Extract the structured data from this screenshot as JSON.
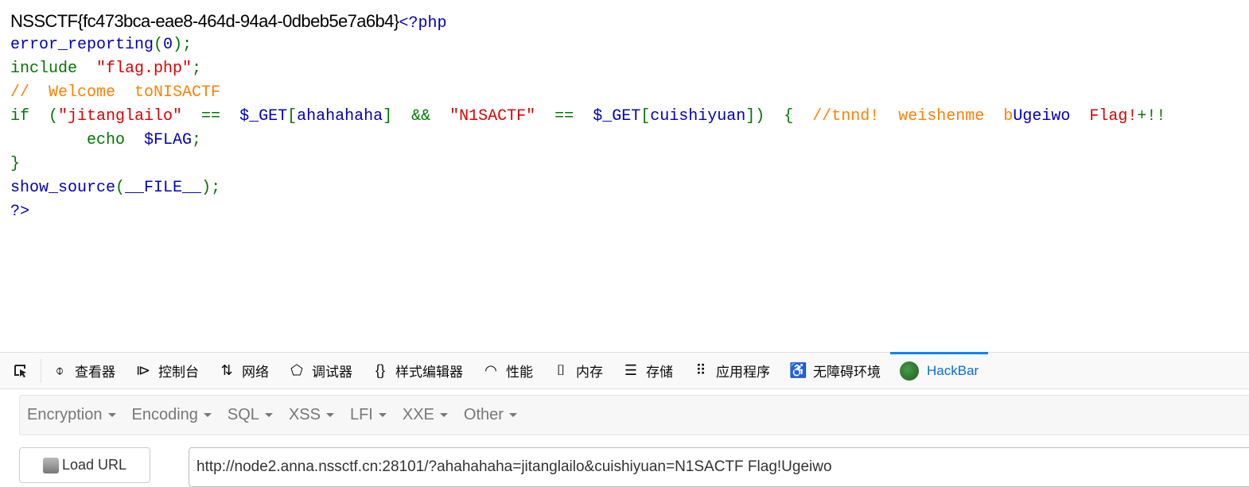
{
  "page": {
    "flag_text": "NSSCTF{fc473bca-eae8-464d-94a4-0dbeb5e7a6b4}",
    "source_lines": [
      [
        [
          "<?php",
          "default"
        ]
      ],
      [
        [
          "error_reporting",
          "default"
        ],
        [
          "(",
          "keyword"
        ],
        [
          "0",
          "default"
        ],
        [
          ");",
          "keyword"
        ]
      ],
      [
        [
          "include  ",
          "keyword"
        ],
        [
          "\"flag.php\"",
          "string"
        ],
        [
          ";",
          "keyword"
        ]
      ],
      [
        [
          "//  Welcome  toNISACTF",
          "comment"
        ]
      ],
      [
        [
          "if  (",
          "keyword"
        ],
        [
          "\"jitanglailo\"",
          "string"
        ],
        [
          "  ==  ",
          "keyword"
        ],
        [
          "$_GET",
          "default"
        ],
        [
          "[",
          "keyword"
        ],
        [
          "ahahahaha",
          "default"
        ],
        [
          "]  &&  ",
          "keyword"
        ],
        [
          "\"N1SACTF\"",
          "string"
        ],
        [
          "  ==  ",
          "keyword"
        ],
        [
          "$_GET",
          "default"
        ],
        [
          "[",
          "keyword"
        ],
        [
          "cuishiyuan",
          "default"
        ],
        [
          "])  {  ",
          "keyword"
        ],
        [
          "//tnnd!  weishenme  b",
          "comment"
        ],
        [
          "Ugeiwo  ",
          "default"
        ],
        [
          "Flag!",
          "string"
        ],
        [
          "+!!",
          "keyword"
        ]
      ],
      [
        [
          "        echo  ",
          "keyword"
        ],
        [
          "$FLAG",
          "default"
        ],
        [
          ";",
          "keyword"
        ]
      ],
      [
        [
          "}",
          "keyword"
        ]
      ],
      [
        [
          "show_source",
          "default"
        ],
        [
          "(",
          "keyword"
        ],
        [
          "__FILE__",
          "default"
        ],
        [
          ");",
          "keyword"
        ]
      ],
      [
        [
          "?>",
          "default"
        ]
      ]
    ]
  },
  "devtools": {
    "tabs": [
      {
        "label": "查看器",
        "icon": "inspector-icon"
      },
      {
        "label": "控制台",
        "icon": "console-icon"
      },
      {
        "label": "网络",
        "icon": "network-icon"
      },
      {
        "label": "调试器",
        "icon": "debugger-icon"
      },
      {
        "label": "样式编辑器",
        "icon": "style-editor-icon"
      },
      {
        "label": "性能",
        "icon": "performance-icon"
      },
      {
        "label": "内存",
        "icon": "memory-icon"
      },
      {
        "label": "存储",
        "icon": "storage-icon"
      },
      {
        "label": "应用程序",
        "icon": "application-icon"
      },
      {
        "label": "无障碍环境",
        "icon": "accessibility-icon"
      },
      {
        "label": "HackBar",
        "icon": "hackbar-icon",
        "active": true
      }
    ],
    "accent": "#0a84ff"
  },
  "hackbar": {
    "menus": [
      "Encryption",
      "Encoding",
      "SQL",
      "XSS",
      "LFI",
      "XXE",
      "Other"
    ],
    "load_url_label": "Load URL",
    "url_value": "http://node2.anna.nssctf.cn:28101/?ahahahaha=jitanglailo&cuishiyuan=N1SACTF Flag!Ugeiwo"
  }
}
